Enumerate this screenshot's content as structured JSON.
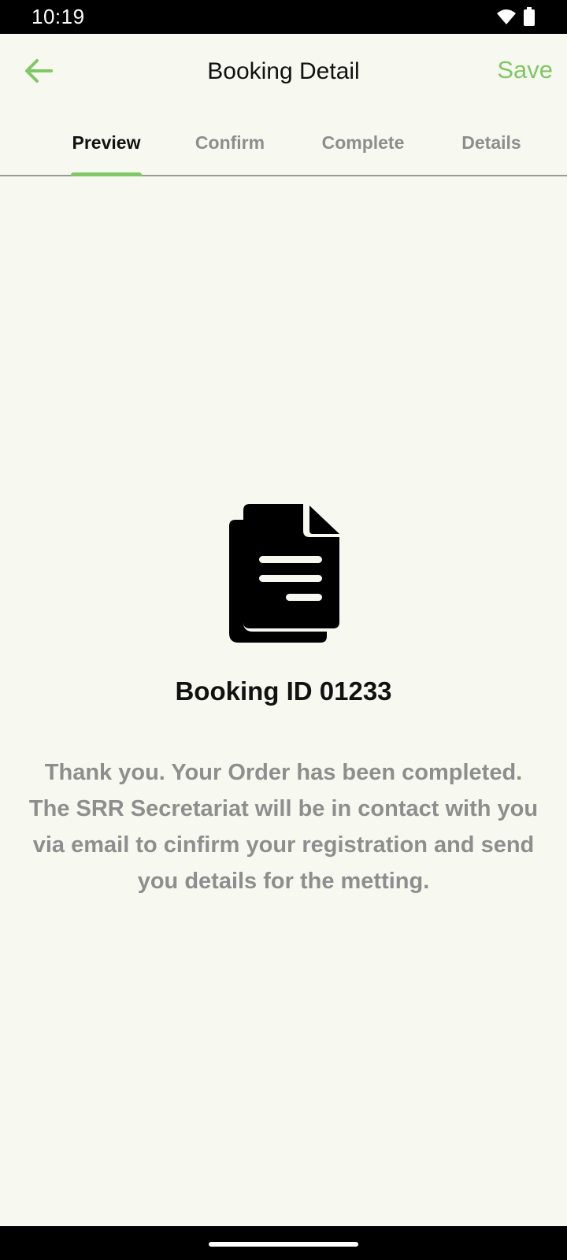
{
  "status_bar": {
    "time": "10:19"
  },
  "app_bar": {
    "title": "Booking Detail",
    "save_label": "Save",
    "back_icon": "arrow-left-icon"
  },
  "tabs": [
    {
      "label": "Preview",
      "active": true
    },
    {
      "label": "Confirm",
      "active": false
    },
    {
      "label": "Complete",
      "active": false
    },
    {
      "label": "Details",
      "active": false
    }
  ],
  "content": {
    "icon": "document-copy-icon",
    "booking_id": "Booking ID 01233",
    "message": "Thank you. Your Order has been completed. The SRR Secretariat will be in contact with you via email to cinfirm your registration and send you details for the metting."
  },
  "colors": {
    "accent": "#80c766",
    "background": "#f7f8f0",
    "muted_text": "#8e8e8e"
  }
}
